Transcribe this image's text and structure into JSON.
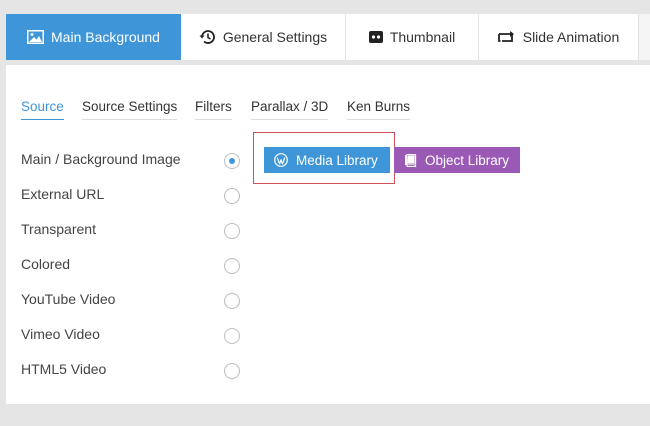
{
  "top_tabs": [
    {
      "label": "Main Background",
      "icon": "image-icon",
      "active": true
    },
    {
      "label": "General Settings",
      "icon": "history-icon",
      "active": false
    },
    {
      "label": "Thumbnail",
      "icon": "thumbnail-icon",
      "active": false
    },
    {
      "label": "Slide Animation",
      "icon": "slide-animation-icon",
      "active": false
    }
  ],
  "sub_tabs": [
    {
      "label": "Source",
      "active": true
    },
    {
      "label": "Source Settings",
      "active": false
    },
    {
      "label": "Filters",
      "active": false
    },
    {
      "label": "Parallax / 3D",
      "active": false
    },
    {
      "label": "Ken Burns",
      "active": false
    }
  ],
  "source_options": [
    {
      "label": "Main / Background Image",
      "checked": true
    },
    {
      "label": "External URL",
      "checked": false
    },
    {
      "label": "Transparent",
      "checked": false
    },
    {
      "label": "Colored",
      "checked": false
    },
    {
      "label": "YouTube Video",
      "checked": false
    },
    {
      "label": "Vimeo Video",
      "checked": false
    },
    {
      "label": "HTML5 Video",
      "checked": false
    }
  ],
  "buttons": {
    "media_library": {
      "label": "Media Library",
      "icon": "wordpress-icon",
      "color": "#3e96d8"
    },
    "object_library": {
      "label": "Object Library",
      "icon": "book-icon",
      "color": "#9b59b6"
    }
  },
  "colors": {
    "accent": "#3e96d8",
    "highlight_border": "#d0505a"
  }
}
